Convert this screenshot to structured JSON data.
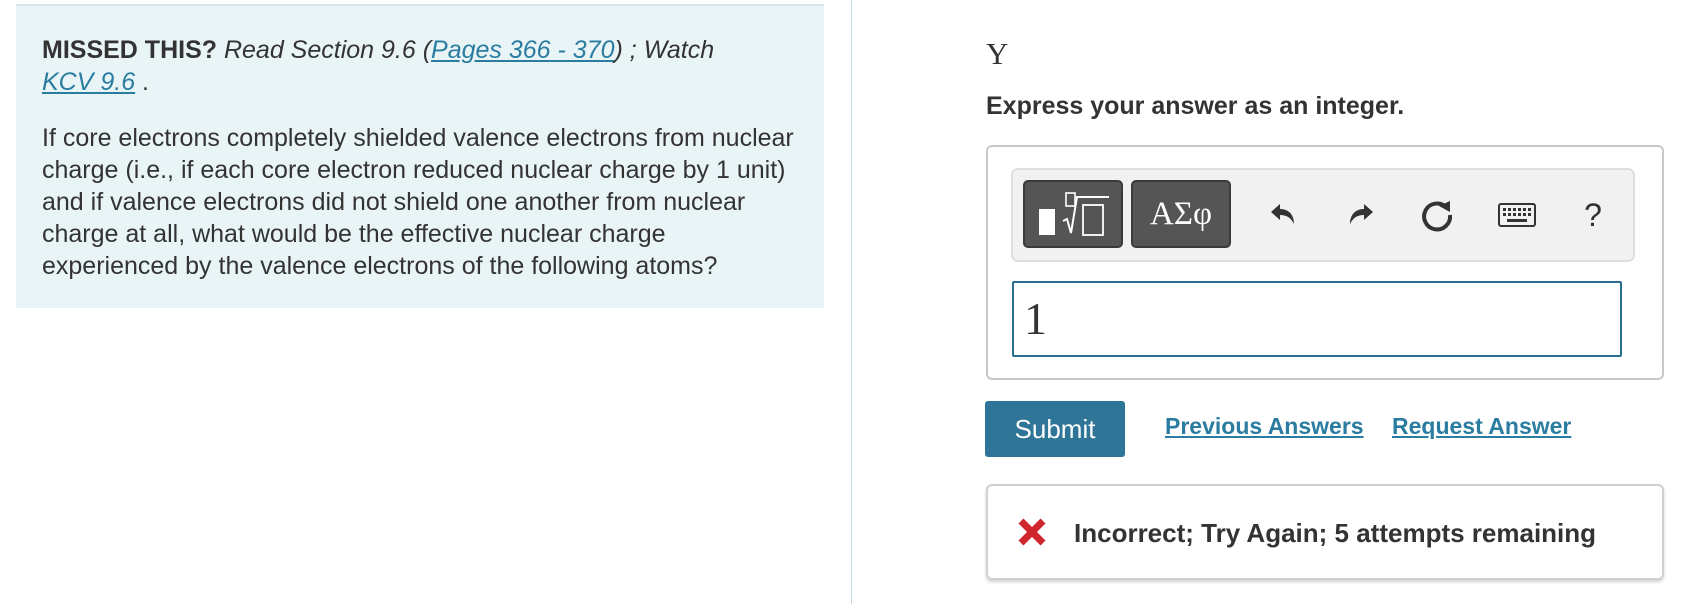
{
  "hint": {
    "missed_label": "MISSED THIS?",
    "read_prefix": "Read Section 9.6 (",
    "pages_link": "Pages 366 - 370",
    "read_suffix": ") ; Watch",
    "kcv_link": "KCV 9.6",
    "period": " .",
    "question": "If core electrons completely shielded valence electrons from nuclear charge (i.e., if each core electron reduced nuclear charge by 1 unit) and if valence electrons did not shield one another from nuclear charge at all, what would be the effective nuclear charge experienced by the valence electrons of the following atoms?"
  },
  "part": {
    "variable": "Y",
    "instruction": "Express your answer as an integer."
  },
  "toolbar": {
    "greek_label": "ΑΣφ",
    "help_label": "?",
    "icons": [
      "templates-icon",
      "greek-symbols-icon",
      "undo-icon",
      "redo-icon",
      "reset-icon",
      "keyboard-icon",
      "help-icon"
    ]
  },
  "answer": {
    "value": "1"
  },
  "actions": {
    "submit_label": "Submit",
    "previous_answers_label": "Previous Answers",
    "request_answer_label": "Request Answer"
  },
  "feedback": {
    "text": "Incorrect; Try Again; 5 attempts remaining",
    "status_color": "#d0262d"
  },
  "colors": {
    "accent": "#2f7597",
    "link": "#2a7ca0",
    "hint_bg": "#e8f4f5"
  }
}
